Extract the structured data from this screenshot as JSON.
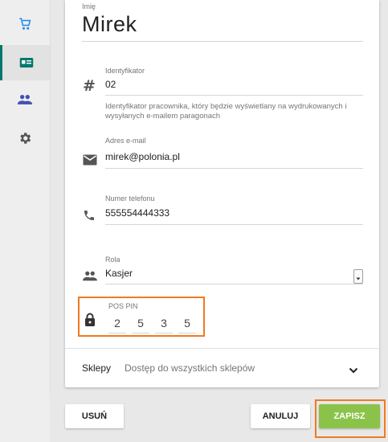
{
  "nav": {
    "items": [
      {
        "icon": "cart-icon",
        "active": false
      },
      {
        "icon": "id-card-icon",
        "active": true
      },
      {
        "icon": "people-icon",
        "active": false
      },
      {
        "icon": "gear-icon",
        "active": false
      }
    ]
  },
  "form": {
    "name": {
      "label": "Imię",
      "value": "Mirek"
    },
    "identifier": {
      "label": "Identyfikator",
      "value": "02",
      "hint": "Identyfikator pracownika, który będzie wyświetlany na wydrukowanych i wysyłanych e-mailem paragonach"
    },
    "email": {
      "label": "Adres e-mail",
      "value": "mirek@polonia.pl"
    },
    "phone": {
      "label": "Numer telefonu",
      "value": "555554444333"
    },
    "role": {
      "label": "Rola",
      "value": "Kasjer"
    },
    "pin": {
      "label": "POS PIN",
      "digits": [
        "2",
        "5",
        "3",
        "5"
      ]
    },
    "shops": {
      "label": "Sklepy",
      "value": "Dostęp do wszystkich sklepów"
    }
  },
  "actions": {
    "delete_label": "USUŃ",
    "cancel_label": "ANULUJ",
    "save_label": "ZAPISZ"
  },
  "colors": {
    "accent": "#00796b",
    "save": "#8bc34a",
    "highlight": "#f07a20"
  }
}
